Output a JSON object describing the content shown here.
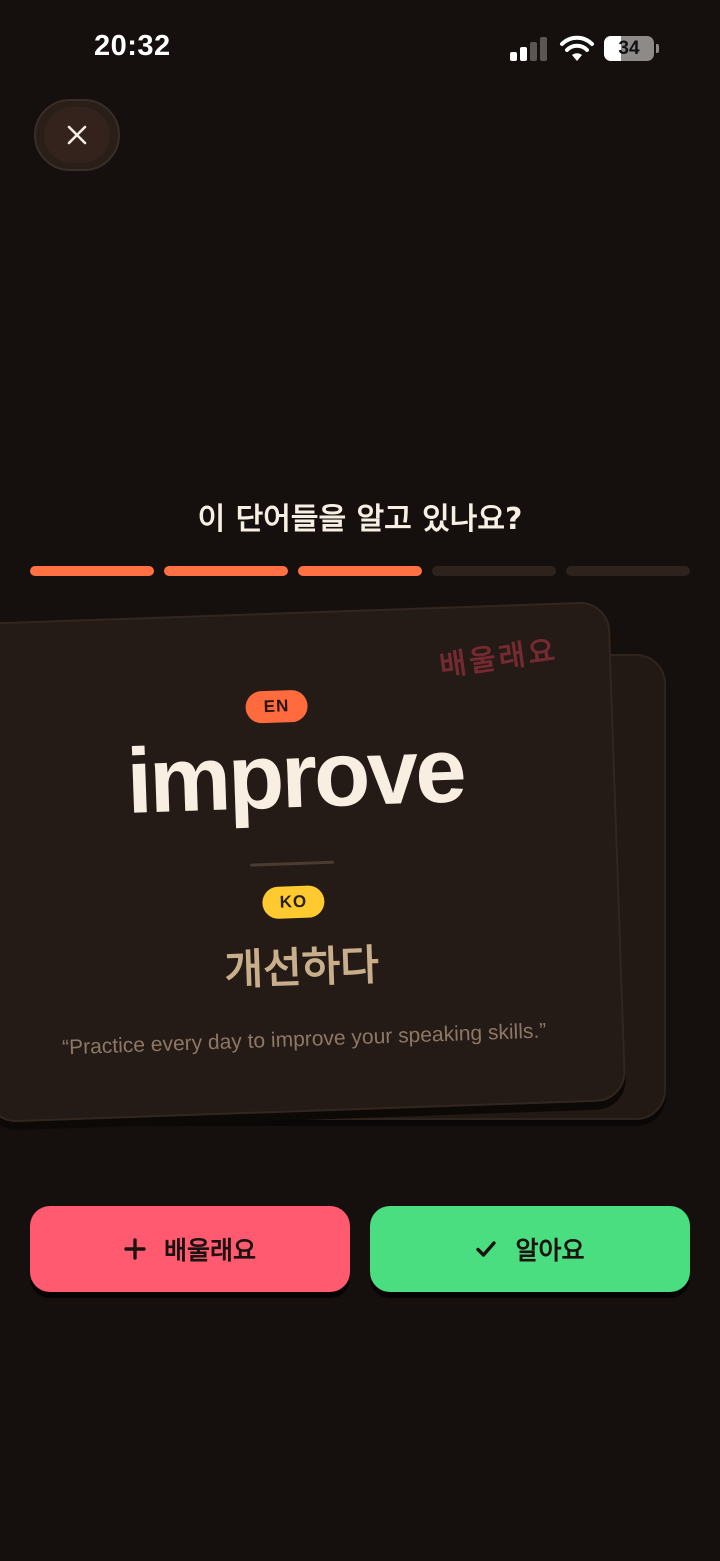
{
  "status_bar": {
    "time": "20:32",
    "battery_level": "34",
    "icons": [
      "signal-icon",
      "wifi-icon",
      "battery-icon"
    ]
  },
  "header": {
    "close_icon": "close-icon"
  },
  "quiz": {
    "title": "이 단어들을 알고 있나요?",
    "progress": {
      "completed": 3,
      "total": 5
    }
  },
  "card": {
    "stamp": "배울래요",
    "source_lang": "EN",
    "word": "improve",
    "target_lang": "KO",
    "translation": "개선하다",
    "example": "“Practice every day to improve your speaking skills.”"
  },
  "actions": {
    "learn_label": "배울래요",
    "learn_icon": "plus-icon",
    "know_label": "알아요",
    "know_icon": "check-icon"
  },
  "colors": {
    "background": "#15100e",
    "card": "#241a16",
    "progress_active": "#ff7043",
    "en_badge": "#ff6b3d",
    "ko_badge": "#ffc930",
    "learn_button": "#ff5a70",
    "know_button": "#4ade80"
  }
}
